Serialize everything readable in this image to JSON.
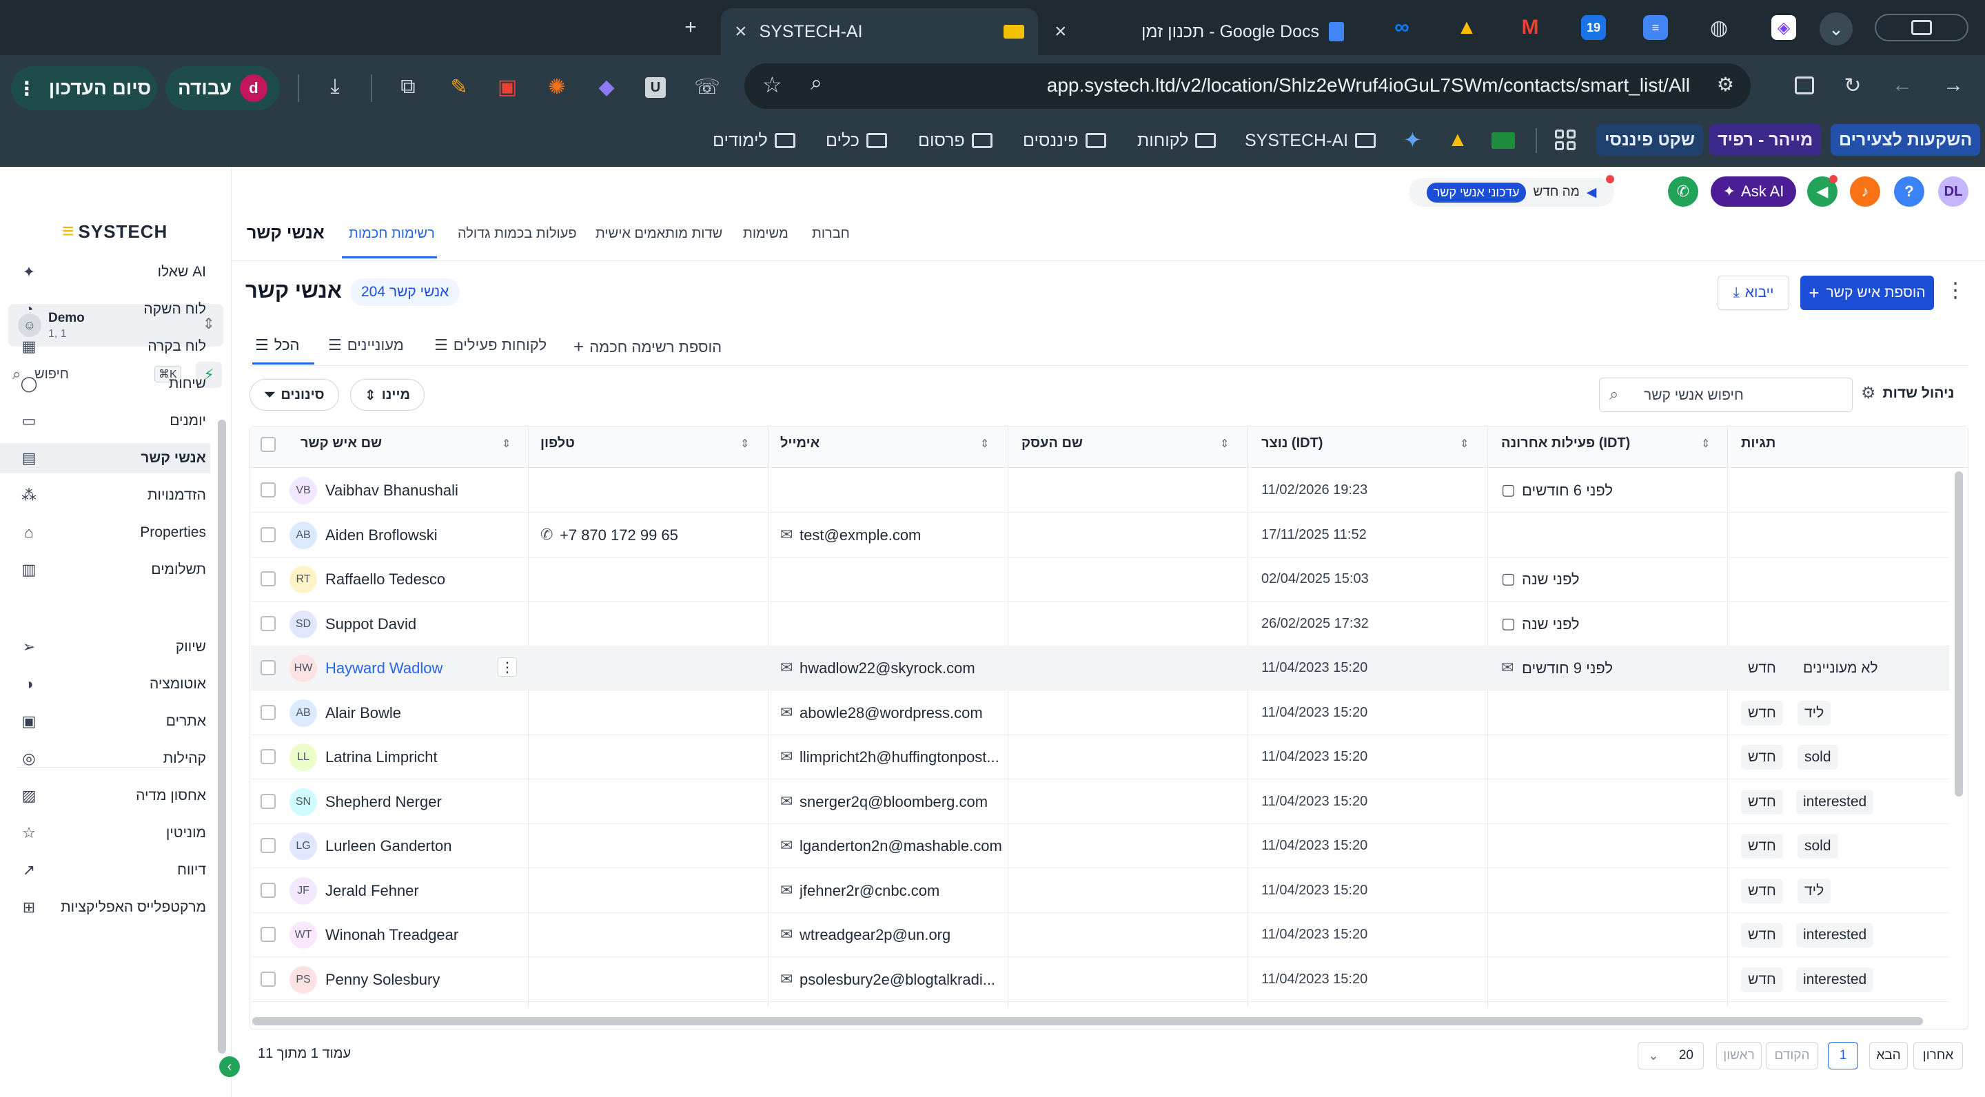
{
  "browser": {
    "tabs": [
      {
        "title": "SYSTECH-AI",
        "active": true
      },
      {
        "title": "תכנון זמן - Google Docs",
        "active": false
      }
    ],
    "pinned_tabs": [
      "meta",
      "google-drive",
      "gmail",
      "calendar-19",
      "docs",
      "globe",
      "clickup"
    ],
    "calendar_day": "19",
    "url": "app.systech.ltd/v2/location/Shlz2eWruf4ioGuL7SWm/contacts/smart_list/All",
    "profile_label": "עבודה",
    "profile_initial": "d",
    "finish_update_label": "סיום העדכון",
    "extension_u_label": "U",
    "bookmarks": [
      "השקעות לצעירים",
      "מייהר - רפיד",
      "שקט פיננסי",
      "SYSTECH-AI",
      "לקוחות",
      "פיננסים",
      "פרסום",
      "כלים",
      "לימודים"
    ]
  },
  "app": {
    "logo_text": "SYSTECH",
    "account": {
      "name": "Demo",
      "sub": "1, 1"
    },
    "search": {
      "placeholder": "חיפוש",
      "shortcut": "⌘K"
    },
    "sidebar_items": [
      {
        "label": "שאלו AI",
        "icon": "sparkle-icon"
      },
      {
        "label": "לוח השקה",
        "icon": "rocket-icon"
      },
      {
        "label": "לוח בקרה",
        "icon": "dashboard-icon"
      },
      {
        "label": "שיחות",
        "icon": "chat-icon"
      },
      {
        "label": "יומנים",
        "icon": "calendar-icon"
      },
      {
        "label": "אנשי קשר",
        "icon": "contacts-icon",
        "active": true
      },
      {
        "label": "הזדמנויות",
        "icon": "opportunities-icon"
      },
      {
        "label": "Properties",
        "icon": "home-icon"
      },
      {
        "label": "תשלומים",
        "icon": "payments-icon"
      },
      {
        "label": "שיווק",
        "icon": "send-icon"
      },
      {
        "label": "אוטומציה",
        "icon": "automation-icon"
      },
      {
        "label": "אתרים",
        "icon": "sites-icon"
      },
      {
        "label": "קהילות",
        "icon": "community-icon"
      },
      {
        "label": "אחסון מדיה",
        "icon": "media-icon"
      },
      {
        "label": "מוניטין",
        "icon": "star-icon"
      },
      {
        "label": "דיווח",
        "icon": "report-icon"
      },
      {
        "label": "מרקטפלייס האפליקציות",
        "icon": "apps-icon"
      }
    ],
    "header": {
      "page_title": "אנשי קשר",
      "whats_new": "מה חדש",
      "contacts_updates": "עדכוני אנשי קשר",
      "ask_ai": "Ask AI",
      "user_initials": "DL",
      "help": "?"
    },
    "nav_tabs": [
      "אנשי קשר",
      "רשימות חכמות",
      "פעולות בכמות גדולה",
      "שדות מותאמים אישית",
      "משימות",
      "חברות"
    ],
    "content": {
      "title": "אנשי קשר",
      "count": "204 אנשי קשר",
      "add_contact": "הוספת איש קשר",
      "import": "ייבוא",
      "list_tabs": [
        "הכל",
        "מעוניינים",
        "לקוחות פעילים"
      ],
      "add_smart_list": "הוספת רשימה חכמה",
      "manage_fields": "ניהול שדות",
      "search_contacts_placeholder": "חיפוש אנשי קשר",
      "sort_label": "מיינו",
      "filter_label": "סינונים"
    },
    "table": {
      "columns": [
        "שם איש קשר",
        "טלפון",
        "אימייל",
        "שם העסק",
        "נוצר (IDT)",
        "פעילות אחרונה (IDT)",
        "תגיות"
      ],
      "rows": [
        {
          "initials": "VB",
          "name": "Vaibhav Bhanushali",
          "phone": "",
          "email": "",
          "business": "",
          "created": "11/02/2026 19:23",
          "activity": "לפני 6 חודשים",
          "activity_icon": "chat-icon",
          "tags": []
        },
        {
          "initials": "AB",
          "name": "Aiden Broflowski",
          "phone": "+7 870 172 99 65",
          "email": "test@exmple.com",
          "business": "",
          "created": "17/11/2025 11:52",
          "activity": "",
          "activity_icon": "",
          "tags": []
        },
        {
          "initials": "RT",
          "name": "Raffaello Tedesco",
          "phone": "",
          "email": "",
          "business": "",
          "created": "02/04/2025 15:03",
          "activity": "לפני שנה",
          "activity_icon": "chat-icon",
          "tags": []
        },
        {
          "initials": "SD",
          "name": "Suppot David",
          "phone": "",
          "email": "",
          "business": "",
          "created": "26/02/2025 17:32",
          "activity": "לפני שנה",
          "activity_icon": "chat-icon",
          "tags": []
        },
        {
          "initials": "HW",
          "name": "Hayward Wadlow",
          "phone": "",
          "email": "hwadlow22@skyrock.com",
          "business": "",
          "created": "11/04/2023 15:20",
          "activity": "לפני 9 חודשים",
          "activity_icon": "mail-icon",
          "tags": [
            "לא מעוניינים",
            "חדש"
          ],
          "highlight": true
        },
        {
          "initials": "AB",
          "name": "Alair Bowle",
          "phone": "",
          "email": "abowle28@wordpress.com",
          "business": "",
          "created": "11/04/2023 15:20",
          "activity": "",
          "activity_icon": "",
          "tags": [
            "ליד",
            "חדש"
          ]
        },
        {
          "initials": "LL",
          "name": "Latrina Limpricht",
          "phone": "",
          "email": "llimpricht2h@huffingtonpost...",
          "business": "",
          "created": "11/04/2023 15:20",
          "activity": "",
          "activity_icon": "",
          "tags": [
            "sold",
            "חדש"
          ]
        },
        {
          "initials": "SN",
          "name": "Shepherd Nerger",
          "phone": "",
          "email": "snerger2q@bloomberg.com",
          "business": "",
          "created": "11/04/2023 15:20",
          "activity": "",
          "activity_icon": "",
          "tags": [
            "interested",
            "חדש"
          ]
        },
        {
          "initials": "LG",
          "name": "Lurleen Ganderton",
          "phone": "",
          "email": "lganderton2n@mashable.com",
          "business": "",
          "created": "11/04/2023 15:20",
          "activity": "",
          "activity_icon": "",
          "tags": [
            "sold",
            "חדש"
          ]
        },
        {
          "initials": "JF",
          "name": "Jerald Fehner",
          "phone": "",
          "email": "jfehner2r@cnbc.com",
          "business": "",
          "created": "11/04/2023 15:20",
          "activity": "",
          "activity_icon": "",
          "tags": [
            "ליד",
            "חדש"
          ]
        },
        {
          "initials": "WT",
          "name": "Winonah Treadgear",
          "phone": "",
          "email": "wtreadgear2p@un.org",
          "business": "",
          "created": "11/04/2023 15:20",
          "activity": "",
          "activity_icon": "",
          "tags": [
            "interested",
            "חדש"
          ]
        },
        {
          "initials": "PS",
          "name": "Penny Solesbury",
          "phone": "",
          "email": "psolesbury2e@blogtalkradi...",
          "business": "",
          "created": "11/04/2023 15:20",
          "activity": "",
          "activity_icon": "",
          "tags": [
            "interested",
            "חדש"
          ]
        }
      ]
    },
    "pagination": {
      "page_info": "עמוד 1 מתוך 11",
      "page_size": "20",
      "first": "ראשון",
      "prev": "הקודם",
      "current": "1",
      "next": "הבא",
      "last": "אחרון"
    },
    "colors": {
      "accent": "#2563eb",
      "chrome_dark": "#1f2a33",
      "chrome_toolbar": "#2a3b45",
      "ask_ai": "#4c1d95",
      "call_green": "#22a35a",
      "bell_orange": "#f97316",
      "help_blue": "#3b82f6",
      "avatar_purple": "#a78bfa"
    }
  }
}
